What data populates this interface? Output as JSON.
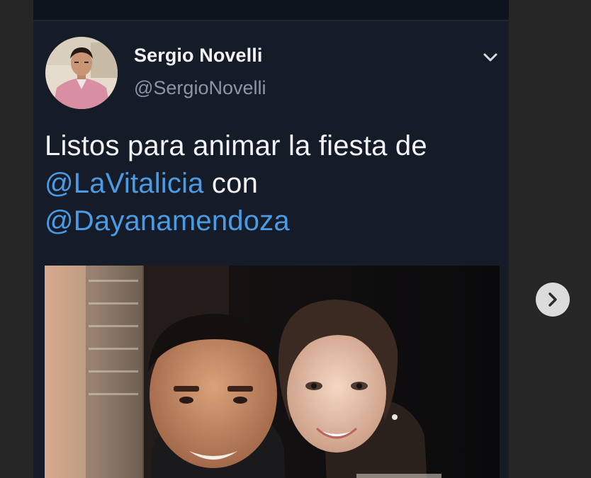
{
  "tweet": {
    "author_name": "Sergio Novelli",
    "author_handle": "@SergioNovelli",
    "text_before": "Listos para animar la fiesta de ",
    "mention_1": "@LaVitalicia",
    "text_middle": " con",
    "mention_2": "@Dayanamendoza"
  },
  "icons": {
    "menu": "chevron-down-icon",
    "next": "chevron-right-icon"
  },
  "colors": {
    "page_background": "#262626",
    "tweet_background": "#151c28",
    "mention": "#4a9be6",
    "handle": "#8a96a6",
    "text": "#f2f4f7"
  }
}
